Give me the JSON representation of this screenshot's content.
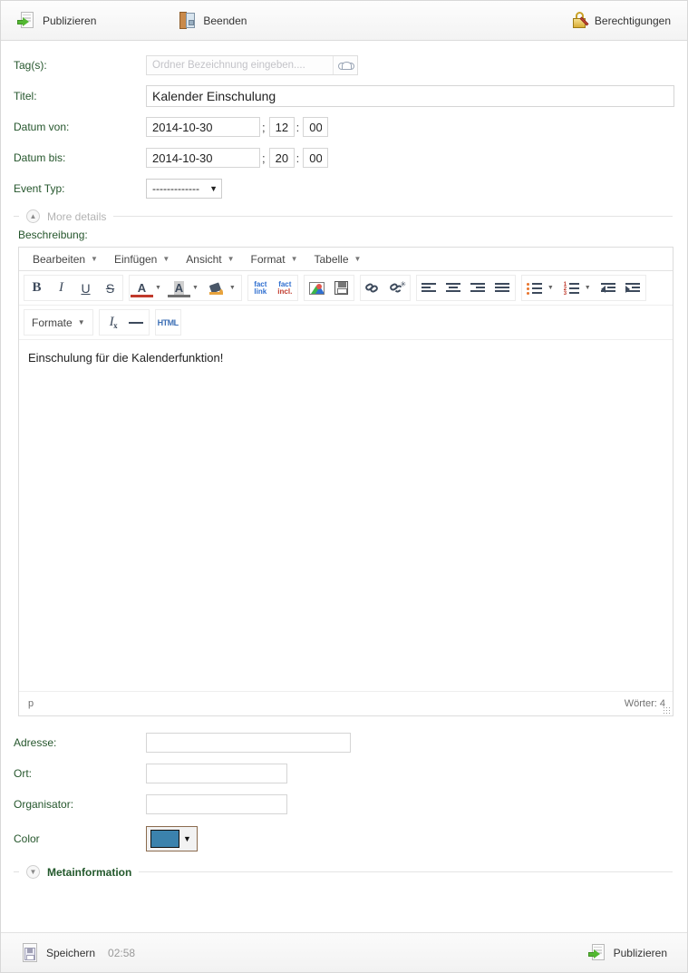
{
  "toolbar": {
    "publish_label": "Publizieren",
    "close_label": "Beenden",
    "permissions_label": "Berechtigungen"
  },
  "form": {
    "tags": {
      "label": "Tag(s):",
      "placeholder": "Ordner Bezeichnung eingeben....",
      "value": ""
    },
    "title": {
      "label": "Titel:",
      "value": "Kalender Einschulung"
    },
    "date_from": {
      "label": "Datum von:",
      "date": "2014-10-30",
      "hour": "12",
      "minute": "00",
      "sep1": ";",
      "sep2": ":"
    },
    "date_to": {
      "label": "Datum bis:",
      "date": "2014-10-30",
      "hour": "20",
      "minute": "00",
      "sep1": ";",
      "sep2": ":"
    },
    "event_type": {
      "label": "Event Typ:",
      "value": "-------------"
    },
    "address": {
      "label": "Adresse:",
      "value": ""
    },
    "city": {
      "label": "Ort:",
      "value": ""
    },
    "organizer": {
      "label": "Organisator:",
      "value": ""
    },
    "color": {
      "label": "Color",
      "value": "#3b82ad"
    }
  },
  "sections": {
    "more_details": "More details",
    "metainformation": "Metainformation"
  },
  "description": {
    "label": "Beschreibung:",
    "menus": [
      "Bearbeiten",
      "Einfügen",
      "Ansicht",
      "Format",
      "Tabelle"
    ],
    "formats_label": "Formate",
    "fact_link": {
      "line1": "fact",
      "line2": "link"
    },
    "fact_incl": {
      "line1": "fact",
      "line2": "incl."
    },
    "content": "Einschulung für die Kalenderfunktion!",
    "status_path": "p",
    "word_count": "Wörter: 4"
  },
  "footer": {
    "save_label": "Speichern",
    "save_time": "02:58",
    "publish_label": "Publizieren"
  },
  "icons": {
    "publish": "publish-arrow-icon",
    "close": "door-exit-icon",
    "permissions": "lock-pencil-icon",
    "tag_browse": "cloud-icon",
    "save": "floppy-save-icon"
  }
}
